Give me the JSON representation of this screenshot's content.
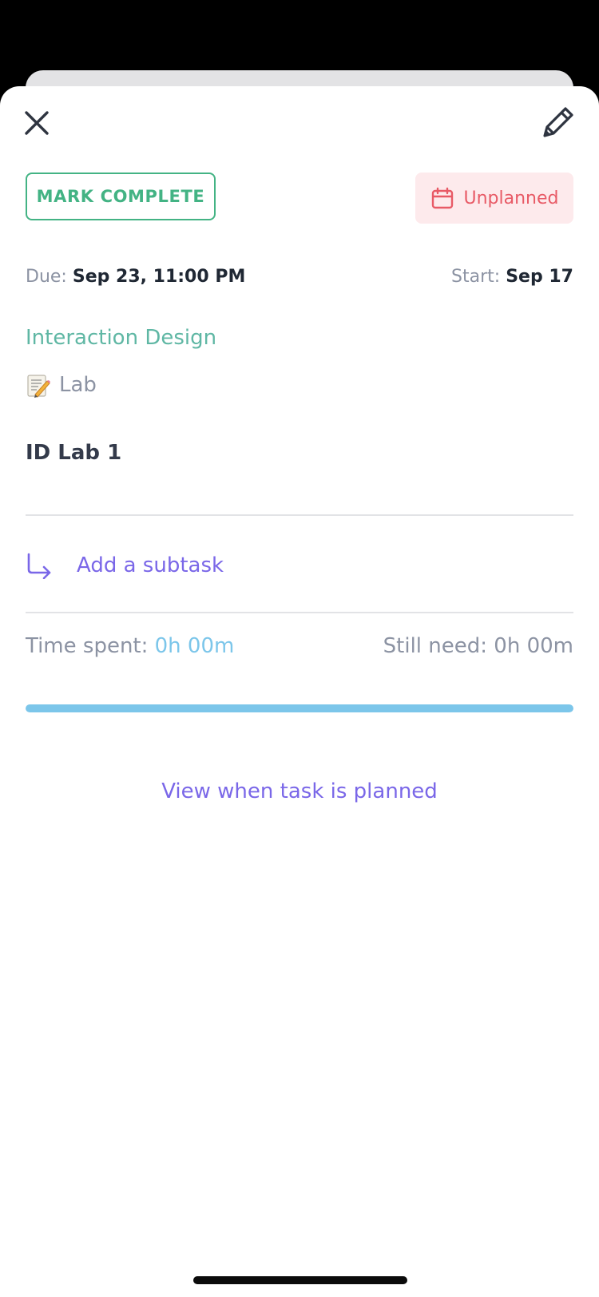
{
  "header": {
    "close_icon": "close-icon",
    "edit_icon": "pencil-icon"
  },
  "actions": {
    "mark_complete_label": "MARK COMPLETE",
    "unplanned_label": "Unplanned",
    "unplanned_icon": "calendar-icon"
  },
  "dates": {
    "due_label": "Due:",
    "due_value": "Sep 23, 11:00 PM",
    "start_label": "Start:",
    "start_value": "Sep 17"
  },
  "task": {
    "course": "Interaction Design",
    "tag_icon": "memo-icon",
    "tag": "Lab",
    "title": "ID Lab 1"
  },
  "subtask": {
    "icon": "arrow-down-right-icon",
    "label": "Add a subtask"
  },
  "time": {
    "spent_label": "Time spent:",
    "spent_value": "0h 00m",
    "need_label": "Still need:",
    "need_value": "0h 00m",
    "progress": 1.0
  },
  "footer": {
    "view_link": "View when task is planned"
  },
  "colors": {
    "accent_green": "#43b384",
    "accent_red": "#e85a66",
    "accent_purple": "#7a67e8",
    "accent_blue": "#7cc6ea",
    "course_teal": "#5fb7a4"
  }
}
